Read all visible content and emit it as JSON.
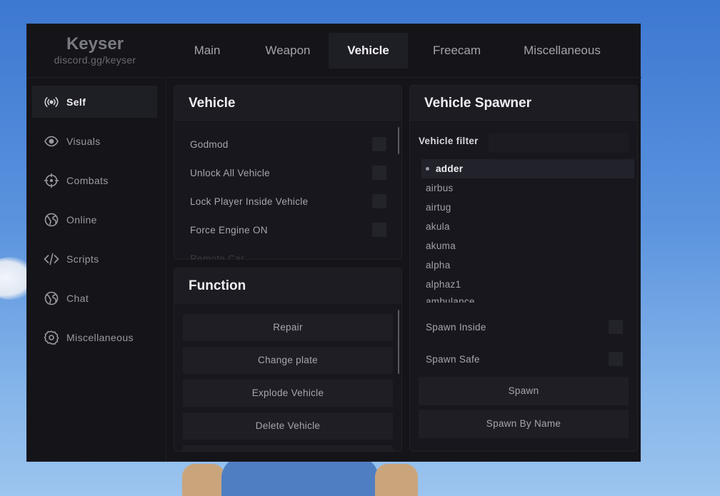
{
  "brand": {
    "title": "Keyser",
    "subtitle": "discord.gg/keyser"
  },
  "tabs": [
    {
      "label": "Main",
      "active": false
    },
    {
      "label": "Weapon",
      "active": false
    },
    {
      "label": "Vehicle",
      "active": true
    },
    {
      "label": "Freecam",
      "active": false
    },
    {
      "label": "Miscellaneous",
      "active": false
    }
  ],
  "sidebar": {
    "items": [
      {
        "label": "Self",
        "icon": "broadcast-icon",
        "active": true
      },
      {
        "label": "Visuals",
        "icon": "eye-icon",
        "active": false
      },
      {
        "label": "Combats",
        "icon": "crosshair-icon",
        "active": false
      },
      {
        "label": "Online",
        "icon": "globe-icon",
        "active": false
      },
      {
        "label": "Scripts",
        "icon": "code-icon",
        "active": false
      },
      {
        "label": "Chat",
        "icon": "globe-icon",
        "active": false
      },
      {
        "label": "Miscellaneous",
        "icon": "gear-icon",
        "active": false
      }
    ]
  },
  "vehicle_panel": {
    "title": "Vehicle",
    "options": [
      {
        "label": "Godmod",
        "checked": false
      },
      {
        "label": "Unlock All Vehicle",
        "checked": false
      },
      {
        "label": "Lock Player Inside Vehicle",
        "checked": false
      },
      {
        "label": "Force Engine ON",
        "checked": false
      }
    ],
    "partial_option": "Remote Car"
  },
  "function_panel": {
    "title": "Function",
    "buttons": [
      "Repair",
      "Change plate",
      "Explode Vehicle",
      "Delete Vehicle"
    ]
  },
  "spawner_panel": {
    "title": "Vehicle Spawner",
    "filter_label": "Vehicle filter",
    "filter_value": "",
    "vehicles": [
      "adder",
      "airbus",
      "airtug",
      "akula",
      "akuma",
      "alpha",
      "alphaz1"
    ],
    "partial_vehicle": "ambulance",
    "selected": "adder",
    "options": [
      {
        "label": "Spawn Inside",
        "checked": false
      },
      {
        "label": "Spawn Safe",
        "checked": false
      }
    ],
    "spawn_label": "Spawn",
    "spawn_by_name_label": "Spawn By Name"
  },
  "colors": {
    "window_bg": "#141419",
    "panel_bg": "#17171d",
    "active_bg": "#1e1e25",
    "text_primary": "#f0f0f4",
    "text_secondary": "#a6a6ae"
  }
}
